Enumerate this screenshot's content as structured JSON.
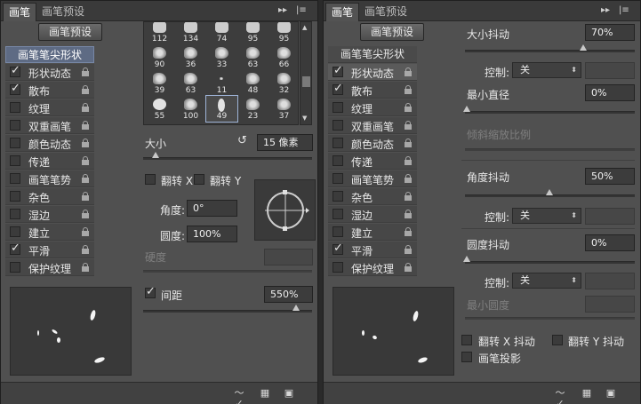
{
  "left": {
    "tabs": [
      "画笔",
      "画笔预设"
    ],
    "preset_button": "画笔预设",
    "list_header": "画笔笔尖形状",
    "list_items": [
      {
        "label": "形状动态",
        "checked": true
      },
      {
        "label": "散布",
        "checked": true
      },
      {
        "label": "纹理",
        "checked": false
      },
      {
        "label": "双重画笔",
        "checked": false
      },
      {
        "label": "颜色动态",
        "checked": false
      },
      {
        "label": "传递",
        "checked": false
      },
      {
        "label": "画笔笔势",
        "checked": false
      },
      {
        "label": "杂色",
        "checked": false
      },
      {
        "label": "湿边",
        "checked": false
      },
      {
        "label": "建立",
        "checked": false
      },
      {
        "label": "平滑",
        "checked": true
      },
      {
        "label": "保护纹理",
        "checked": false
      }
    ],
    "brush_grid": [
      "112",
      "134",
      "74",
      "95",
      "95",
      "90",
      "36",
      "33",
      "63",
      "66",
      "39",
      "63",
      "11",
      "48",
      "32",
      "55",
      "100",
      "49",
      "23",
      "37"
    ],
    "selected_brush_index": 17,
    "size_label": "大小",
    "size_value": "15 像素",
    "flip_x": "翻转 X",
    "flip_y": "翻转 Y",
    "angle_label": "角度:",
    "angle_value": "0°",
    "roundness_label": "圆度:",
    "roundness_value": "100%",
    "hardness_label": "硬度",
    "spacing_label": "间距",
    "spacing_checked": true,
    "spacing_value": "550%"
  },
  "right": {
    "tabs": [
      "画笔",
      "画笔预设"
    ],
    "preset_button": "画笔预设",
    "list_header": "画笔笔尖形状",
    "size_jitter_label": "大小抖动",
    "size_jitter_value": "70%",
    "control_label": "控制:",
    "control_value": "关",
    "min_diameter_label": "最小直径",
    "min_diameter_value": "0%",
    "tilt_scale_label": "倾斜缩放比例",
    "angle_jitter_label": "角度抖动",
    "angle_jitter_value": "50%",
    "roundness_jitter_label": "圆度抖动",
    "roundness_jitter_value": "0%",
    "min_roundness_label": "最小圆度",
    "flip_x_jitter": "翻转 X 抖动",
    "flip_y_jitter": "翻转 Y 抖动",
    "brush_projection": "画笔投影"
  },
  "colors": {
    "selected_header": "#5e6b84",
    "panel": "#535353"
  }
}
